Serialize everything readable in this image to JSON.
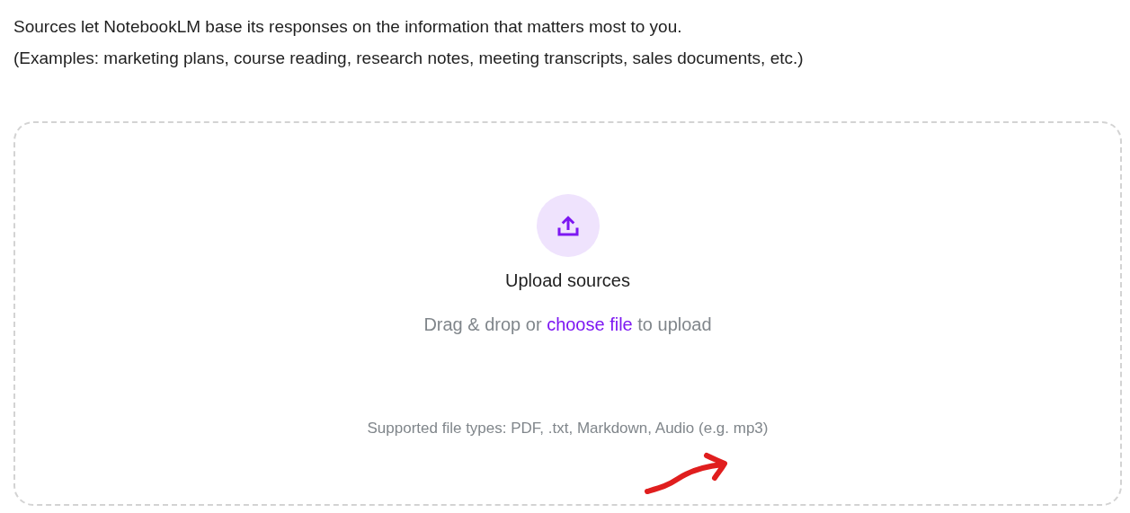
{
  "intro": [
    "Sources let NotebookLM base its responses on the information that matters most to you.",
    "(Examples: marketing plans, course reading, research notes, meeting transcripts, sales documents, etc.)"
  ],
  "upload": {
    "title": "Upload sources",
    "hint_before": "Drag & drop or ",
    "link": "choose file",
    "hint_after": " to upload",
    "supported": "Supported file types: PDF, .txt, Markdown, Audio (e.g. mp3)"
  }
}
